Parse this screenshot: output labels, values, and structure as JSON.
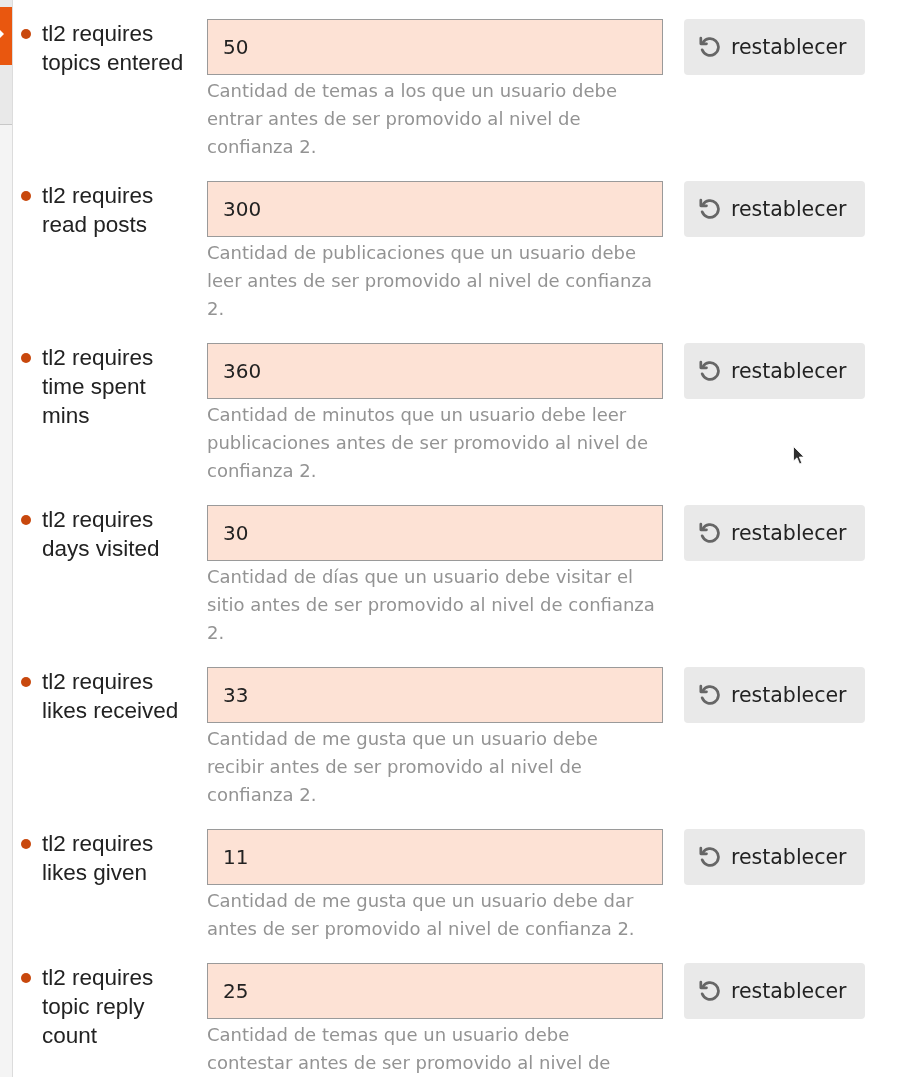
{
  "settings": [
    {
      "label": "tl2 requires topics entered",
      "overridden": true,
      "value": "50",
      "description": "Cantidad de temas a los que un usuario debe entrar antes de ser promovido al nivel de confianza 2.",
      "reset_label": "restablecer"
    },
    {
      "label": "tl2 requires read posts",
      "overridden": true,
      "value": "300",
      "description": "Cantidad de publicaciones que un usuario debe leer antes de ser promovido al nivel de confianza 2.",
      "reset_label": "restablecer"
    },
    {
      "label": "tl2 requires time spent mins",
      "overridden": true,
      "value": "360",
      "description": "Cantidad de minutos que un usuario debe leer publicaciones antes de ser promovido al nivel de confianza 2.",
      "reset_label": "restablecer"
    },
    {
      "label": "tl2 requires days visited",
      "overridden": true,
      "value": "30",
      "description": "Cantidad de días que un usuario debe visitar el sitio antes de ser promovido al nivel de confianza 2.",
      "reset_label": "restablecer"
    },
    {
      "label": "tl2 requires likes received",
      "overridden": true,
      "value": "33",
      "description": "Cantidad de me gusta que un usuario debe recibir antes de ser promovido al nivel de confianza 2.",
      "reset_label": "restablecer"
    },
    {
      "label": "tl2 requires likes given",
      "overridden": true,
      "value": "11",
      "description": "Cantidad de me gusta que un usuario debe dar antes de ser promovido al nivel de confianza 2.",
      "reset_label": "restablecer"
    },
    {
      "label": "tl2 requires topic reply count",
      "overridden": true,
      "value": "25",
      "description": "Cantidad de temas que un usuario debe contestar antes de ser promovido al nivel de",
      "reset_label": "restablecer"
    }
  ]
}
